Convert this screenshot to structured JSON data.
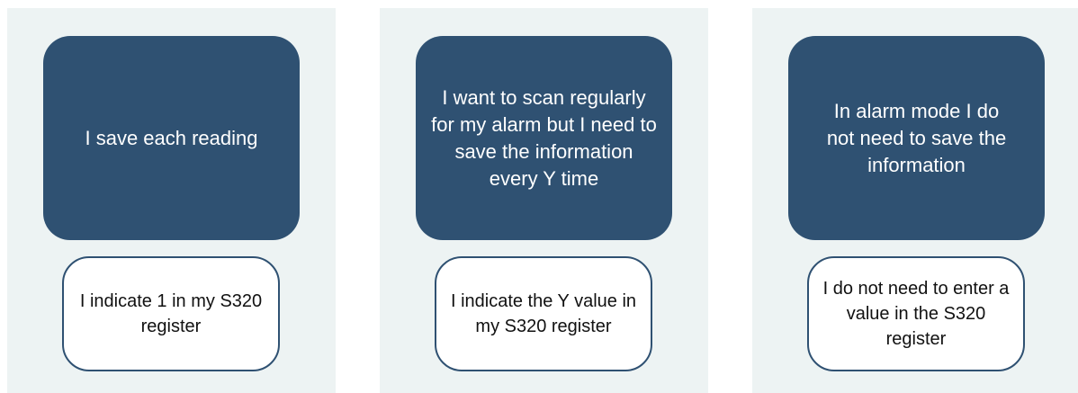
{
  "columns": [
    {
      "top_text": "I save each reading",
      "bottom_text": "I indicate 1 in my S320 register"
    },
    {
      "top_text": "I want to scan regularly for my alarm but I need to save the information every Y time",
      "bottom_text": "I indicate the Y value in my S320 register"
    },
    {
      "top_text": "In alarm mode I do not need to save the information",
      "bottom_text": "I do not need to enter a value in the S320 register"
    }
  ],
  "colors": {
    "panel_background": "#edf3f3",
    "box_fill": "#2f5172",
    "box_text": "#ffffff",
    "outline_box_border": "#2f5172"
  }
}
